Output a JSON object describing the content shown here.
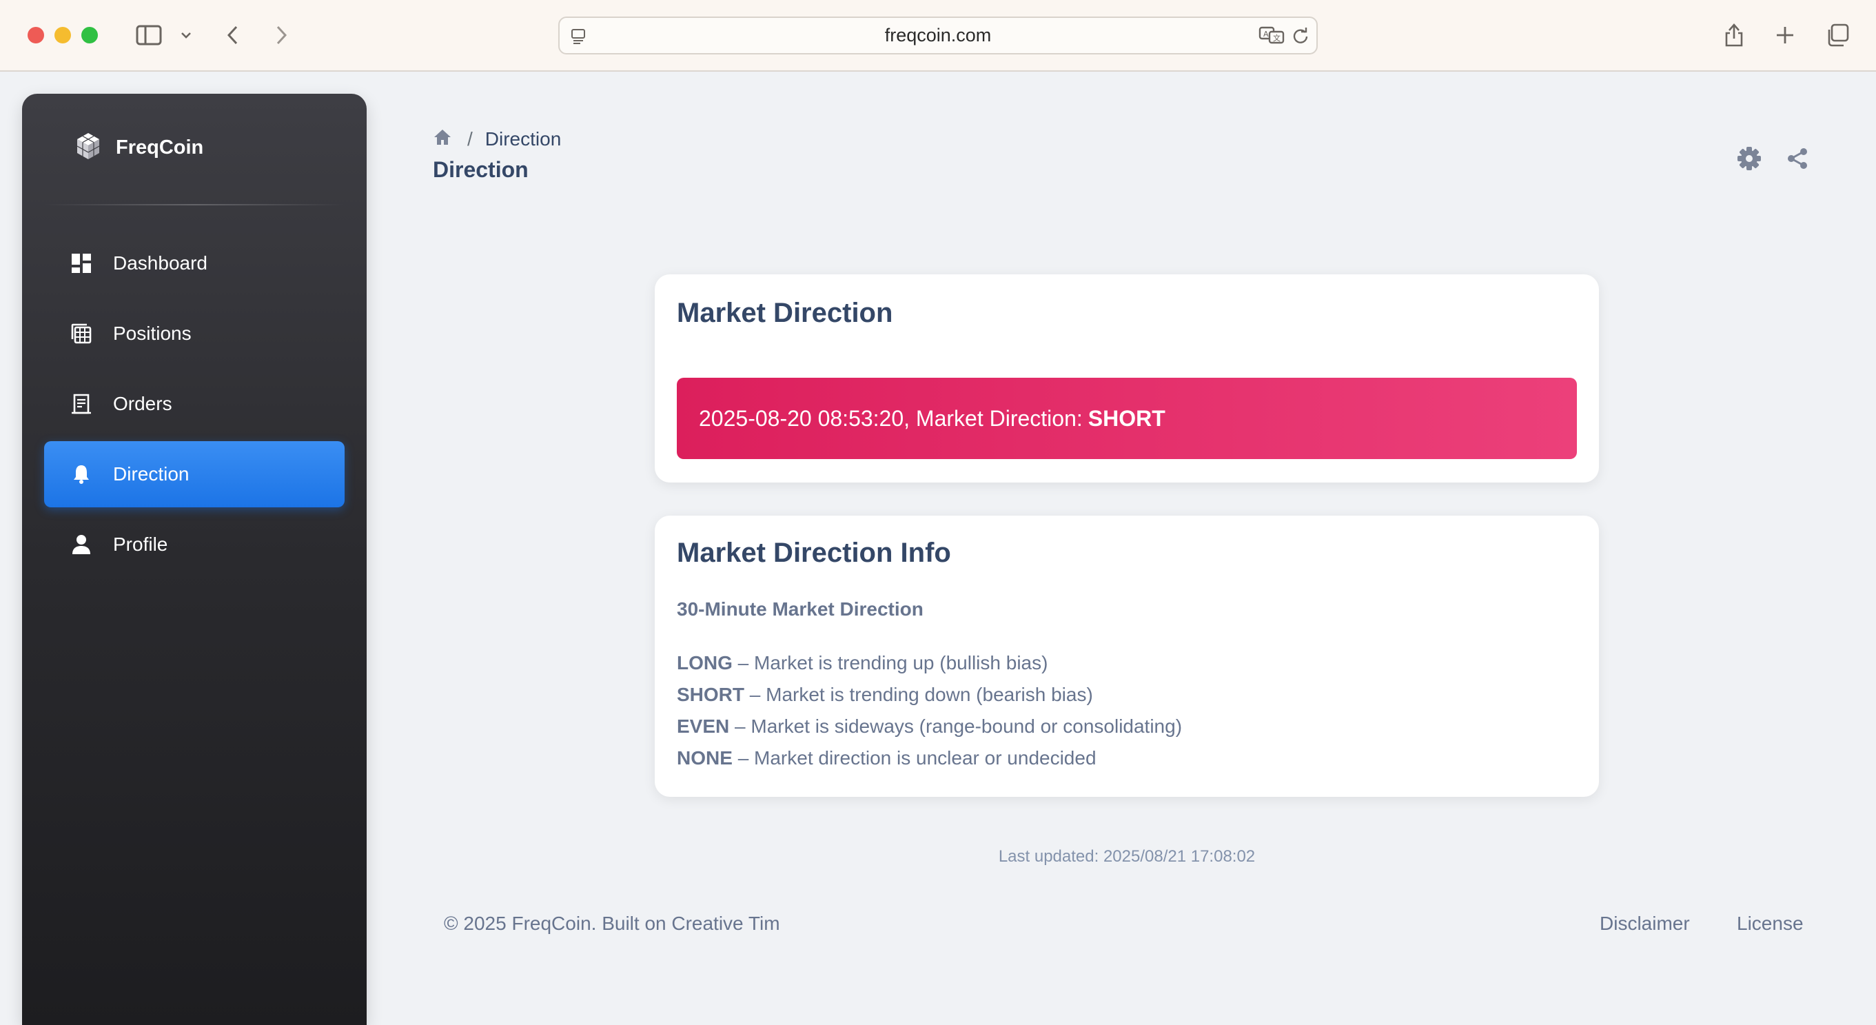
{
  "browser": {
    "url": "freqcoin.com"
  },
  "sidebar": {
    "brand": "FreqCoin",
    "items": [
      {
        "label": "Dashboard",
        "icon": "dashboard-icon",
        "active": false
      },
      {
        "label": "Positions",
        "icon": "table-icon",
        "active": false
      },
      {
        "label": "Orders",
        "icon": "receipt-icon",
        "active": false
      },
      {
        "label": "Direction",
        "icon": "bell-icon",
        "active": true
      },
      {
        "label": "Profile",
        "icon": "person-icon",
        "active": false
      }
    ]
  },
  "header": {
    "breadcrumb_current": "Direction",
    "breadcrumb_sep": "/",
    "title": "Direction"
  },
  "market_card": {
    "title": "Market Direction",
    "alert_prefix": "2025-08-20 08:53:20, Market Direction:",
    "alert_value": "SHORT"
  },
  "info_card": {
    "title": "Market Direction Info",
    "subtitle": "30-Minute Market Direction",
    "items": [
      {
        "key": "LONG",
        "desc": "– Market is trending up (bullish bias)"
      },
      {
        "key": "SHORT",
        "desc": "– Market is trending down (bearish bias)"
      },
      {
        "key": "EVEN",
        "desc": "– Market is sideways (range-bound or consolidating)"
      },
      {
        "key": "NONE",
        "desc": "– Market direction is unclear or undecided"
      }
    ]
  },
  "last_updated": "Last updated: 2025/08/21 17:08:02",
  "footer": {
    "copyright": "© 2025 FreqCoin. Built on Creative Tim",
    "links": [
      "Disclaimer",
      "License"
    ]
  },
  "colors": {
    "accent": "#1a73e8",
    "alert": "#e91e63",
    "heading": "#344767",
    "text": "#67748e"
  }
}
